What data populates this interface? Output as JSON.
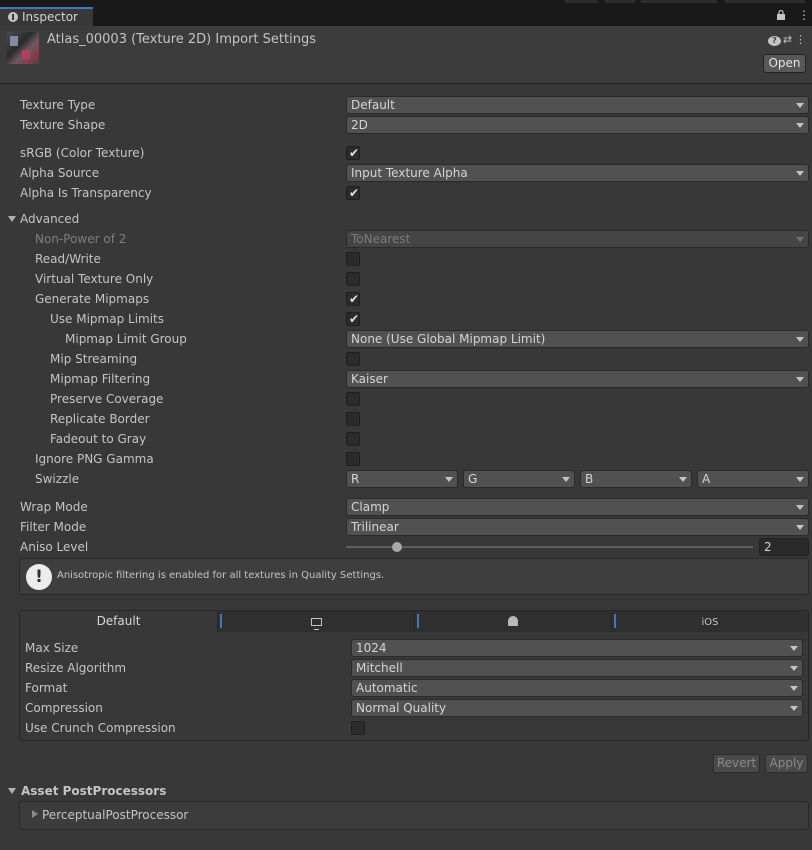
{
  "tab": {
    "title": "Inspector"
  },
  "header": {
    "title": "Atlas_00003 (Texture 2D) Import Settings",
    "open_label": "Open",
    "icons": [
      "help-icon",
      "settings-sliders-icon",
      "more-menu-icon"
    ]
  },
  "basic": {
    "texture_type": {
      "label": "Texture Type",
      "value": "Default"
    },
    "texture_shape": {
      "label": "Texture Shape",
      "value": "2D"
    },
    "srgb": {
      "label": "sRGB (Color Texture)",
      "checked": true
    },
    "alpha_source": {
      "label": "Alpha Source",
      "value": "Input Texture Alpha"
    },
    "alpha_transparency": {
      "label": "Alpha Is Transparency",
      "checked": true
    }
  },
  "advanced": {
    "label": "Advanced",
    "non_power_of_2": {
      "label": "Non-Power of 2",
      "value": "ToNearest"
    },
    "read_write": {
      "label": "Read/Write",
      "checked": false
    },
    "virtual_texture": {
      "label": "Virtual Texture Only",
      "checked": false
    },
    "generate_mipmaps": {
      "label": "Generate Mipmaps",
      "checked": true
    },
    "use_mipmap_limits": {
      "label": "Use Mipmap Limits",
      "checked": true
    },
    "mipmap_limit_group": {
      "label": "Mipmap Limit Group",
      "value": "None (Use Global Mipmap Limit)"
    },
    "mip_streaming": {
      "label": "Mip Streaming",
      "checked": false
    },
    "mipmap_filtering": {
      "label": "Mipmap Filtering",
      "value": "Kaiser"
    },
    "preserve_coverage": {
      "label": "Preserve Coverage",
      "checked": false
    },
    "replicate_border": {
      "label": "Replicate Border",
      "checked": false
    },
    "fadeout_gray": {
      "label": "Fadeout to Gray",
      "checked": false
    },
    "ignore_png_gamma": {
      "label": "Ignore PNG Gamma",
      "checked": false
    },
    "swizzle": {
      "label": "Swizzle",
      "values": [
        "R",
        "G",
        "B",
        "A"
      ]
    }
  },
  "sampling": {
    "wrap_mode": {
      "label": "Wrap Mode",
      "value": "Clamp"
    },
    "filter_mode": {
      "label": "Filter Mode",
      "value": "Trilinear"
    },
    "aniso_level": {
      "label": "Aniso Level",
      "value": "2",
      "fraction": 0.125
    }
  },
  "help": {
    "text": "Anisotropic filtering is enabled for all textures in Quality Settings."
  },
  "platform": {
    "tabs": [
      "Default",
      "monitor-icon",
      "android-icon",
      "iOS"
    ],
    "max_size": {
      "label": "Max Size",
      "value": "1024"
    },
    "resize_algorithm": {
      "label": "Resize Algorithm",
      "value": "Mitchell"
    },
    "format": {
      "label": "Format",
      "value": "Automatic"
    },
    "compression": {
      "label": "Compression",
      "value": "Normal Quality"
    },
    "crunch": {
      "label": "Use Crunch Compression",
      "checked": false
    }
  },
  "actions": {
    "revert": "Revert",
    "apply": "Apply"
  },
  "post_processors": {
    "title": "Asset PostProcessors",
    "items": [
      "PerceptualPostProcessor"
    ]
  },
  "colors": {
    "accent": "#3a79bb",
    "background": "#383838"
  }
}
